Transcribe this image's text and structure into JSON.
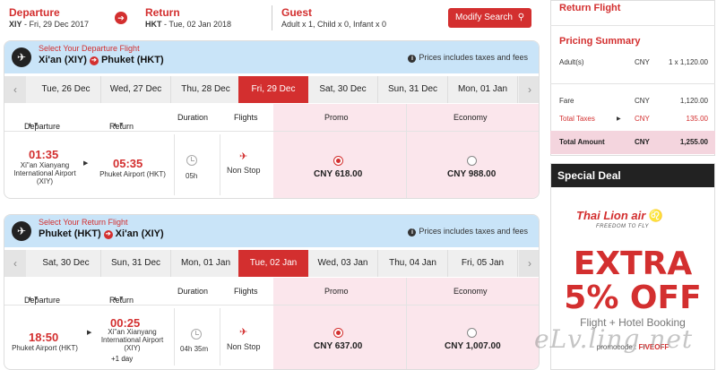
{
  "header": {
    "departure_label": "Departure",
    "departure_code": "XIY",
    "departure_date": " - Fri, 29 Dec 2017",
    "return_label": "Return",
    "return_code": "HKT",
    "return_date": " - Tue, 02 Jan 2018",
    "guest_label": "Guest",
    "guest_value": "Adult x 1, Child x 0, Infant x 0",
    "modify_label": "Modify Search",
    "arrow_icon": "circle-arrow-right-icon",
    "search_icon": "search-icon"
  },
  "columns": {
    "departure": "Departure",
    "return": "Return",
    "duration": "Duration",
    "flights": "Flights",
    "promo": "Promo",
    "economy": "Economy"
  },
  "outbound": {
    "select_label": "Select Your Departure Flight",
    "origin": "Xi'an (XIY)",
    "destination": "Phuket (HKT)",
    "prices_note": "Prices includes taxes and fees",
    "dates": [
      "Tue, 26 Dec",
      "Wed, 27 Dec",
      "Thu, 28 Dec",
      "Fri, 29 Dec",
      "Sat, 30 Dec",
      "Sun, 31 Dec",
      "Mon, 01 Jan"
    ],
    "active_date": "Fri, 29 Dec",
    "flight": {
      "dep_time": "01:35",
      "dep_airport": [
        "Xi\"an Xianyang",
        "International Airport",
        "(XIY)"
      ],
      "arr_time": "05:35",
      "arr_airport": "Phuket Airport (HKT)",
      "duration": "05h",
      "stops": "Non Stop",
      "promo_price": "CNY 618.00",
      "economy_price": "CNY 988.00",
      "selected_fare": "promo"
    }
  },
  "return": {
    "select_label": "Select Your Return Flight",
    "origin": "Phuket (HKT)",
    "destination": "Xi'an (XIY)",
    "prices_note": "Prices includes taxes and fees",
    "dates": [
      "Sat, 30 Dec",
      "Sun, 31 Dec",
      "Mon, 01 Jan",
      "Tue, 02 Jan",
      "Wed, 03 Jan",
      "Thu, 04 Jan",
      "Fri, 05 Jan"
    ],
    "active_date": "Tue, 02 Jan",
    "flight": {
      "dep_time": "18:50",
      "dep_airport": "Phuket Airport (HKT)",
      "arr_time": "00:25",
      "arr_airport": [
        "Xi\"an Xianyang",
        "International Airport",
        "(XIY)"
      ],
      "plus_day": "+1 day",
      "duration": "04h 35m",
      "stops": "Non Stop",
      "promo_price": "CNY 637.00",
      "economy_price": "CNY 1,007.00",
      "selected_fare": "promo"
    }
  },
  "summary": {
    "return_flight_title": "Return Flight",
    "pricing_title": "Pricing Summary",
    "adult_label": "Adult(s)",
    "adult_currency": "CNY",
    "adult_value": "1 x 1,120.00",
    "fare_label": "Fare",
    "fare_currency": "CNY",
    "fare_value": "1,120.00",
    "taxes_label": "Total Taxes",
    "taxes_currency": "CNY",
    "taxes_value": "135.00",
    "total_label": "Total Amount",
    "total_currency": "CNY",
    "total_value": "1,255.00"
  },
  "deal": {
    "title": "Special Deal",
    "logo": "Thai Lion air",
    "tagline": "FREEDOM TO FLY",
    "extra": "EXTRA",
    "off": "5% OFF",
    "subtitle": "Flight + Hotel Booking",
    "promo_prefix": "promocode : ",
    "promo_code": "FIVEOFF"
  },
  "watermark": "eLv.ling.net",
  "colors": {
    "accent": "#d32f2f",
    "header_blue": "#c9e4f8",
    "fare_pink": "#fbe6ec"
  }
}
